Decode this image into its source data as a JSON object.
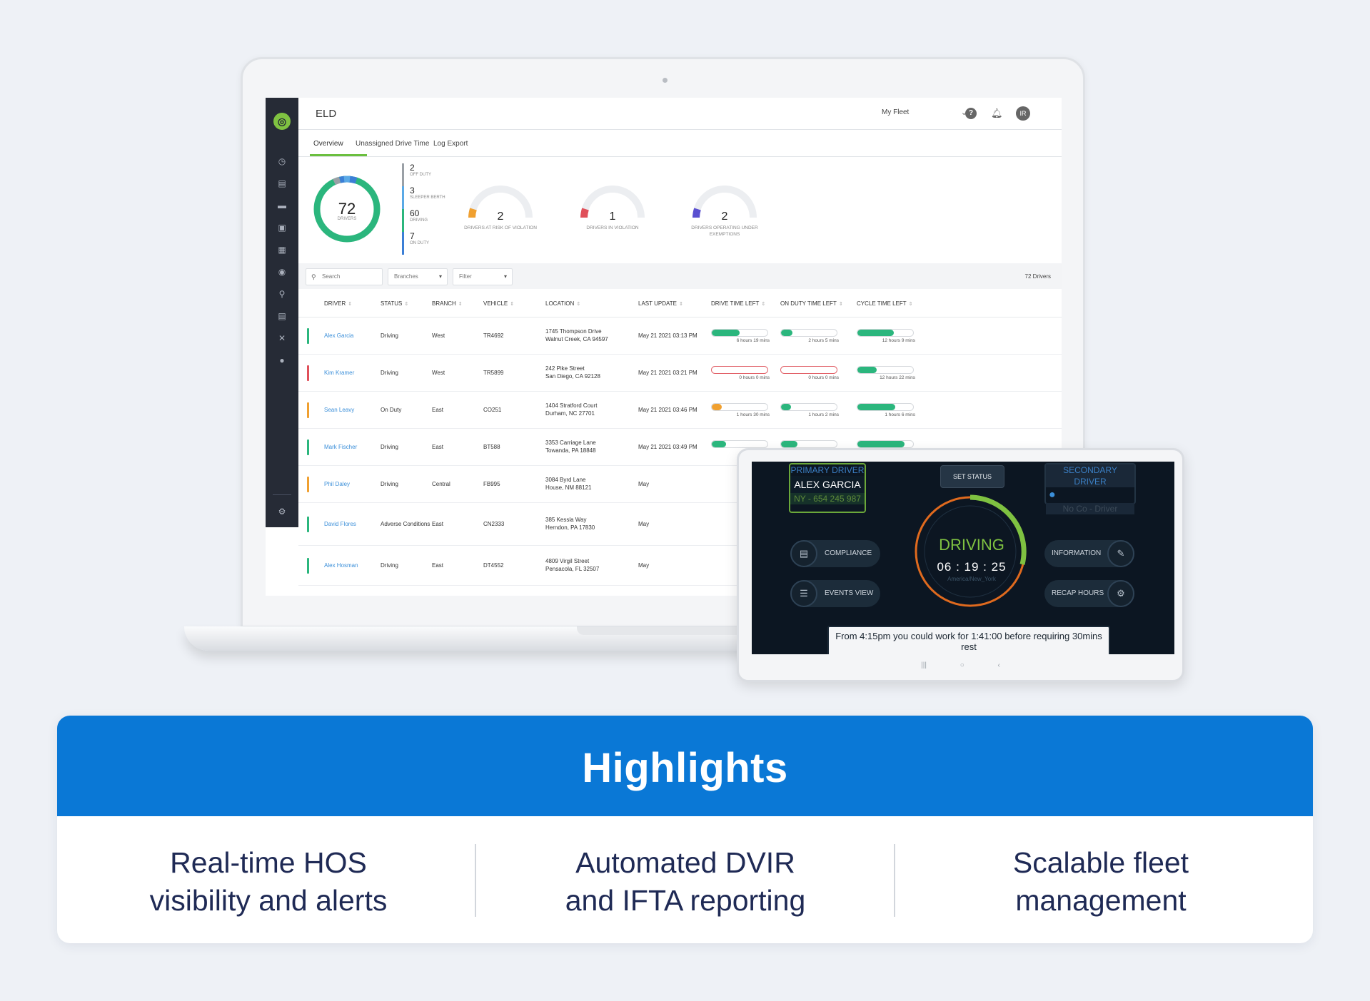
{
  "app": {
    "title": "ELD",
    "fleet_select": "My Fleet",
    "avatar_initials": "IR",
    "tabs": [
      "Overview",
      "Unassigned Drive Time",
      "Log Export"
    ]
  },
  "summary": {
    "total": "72",
    "total_label": "DRIVERS",
    "statuses": [
      {
        "count": "2",
        "label": "OFF DUTY",
        "color": "#9aa0a6"
      },
      {
        "count": "3",
        "label": "SLEEPER BERTH",
        "color": "#5aa9e6"
      },
      {
        "count": "60",
        "label": "DRIVING",
        "color": "#2bb67d"
      },
      {
        "count": "7",
        "label": "ON DUTY",
        "color": "#3b7fd6"
      }
    ],
    "gauges": [
      {
        "count": "2",
        "label": "DRIVERS AT RISK OF VIOLATION",
        "color": "#f0a030"
      },
      {
        "count": "1",
        "label": "DRIVERS IN VIOLATION",
        "color": "#e0505a"
      },
      {
        "count": "2",
        "label": "DRIVERS OPERATING UNDER EXEMPTIONS",
        "color": "#5a50d0"
      }
    ]
  },
  "toolbar": {
    "search_placeholder": "Search",
    "branches": "Branches",
    "filter": "Filter",
    "drivers_count": "72 Drivers"
  },
  "table": {
    "columns": [
      "DRIVER",
      "STATUS",
      "BRANCH",
      "VEHICLE",
      "LOCATION",
      "LAST UPDATE",
      "DRIVE TIME LEFT",
      "ON DUTY TIME LEFT",
      "CYCLE TIME LEFT"
    ],
    "rows": [
      {
        "color": "#2bb67d",
        "driver": "Alex Garcia",
        "status": "Driving",
        "branch": "West",
        "vehicle": "TR4692",
        "loc1": "1745  Thompson Drive",
        "loc2": "Walnut Creek, CA 94597",
        "updated": "May 21 2021 03:13 PM",
        "drive": {
          "fill": 0.5,
          "color": "#2bb67d",
          "text": "6 hours 19 mins"
        },
        "onduty": {
          "fill": 0.2,
          "color": "#2bb67d",
          "text": "2 hours 5 mins"
        },
        "cycle": {
          "fill": 0.65,
          "color": "#2bb67d",
          "text": "12 hours 9 mins"
        }
      },
      {
        "color": "#e0505a",
        "driver": "Kim Kramer",
        "status": "Driving",
        "branch": "West",
        "vehicle": "TR5899",
        "loc1": "242  Pike Street",
        "loc2": "San Diego, CA 92128",
        "updated": "May 21 2021 03:21 PM",
        "drive": {
          "fill": 0,
          "color": "#e0505a",
          "text": "0 hours 0 mins"
        },
        "onduty": {
          "fill": 0,
          "color": "#e0505a",
          "text": "0 hours 0 mins"
        },
        "cycle": {
          "fill": 0.35,
          "color": "#2bb67d",
          "text": "12 hours 22 mins"
        }
      },
      {
        "color": "#f0a030",
        "driver": "Sean Leavy",
        "status": "On Duty",
        "branch": "East",
        "vehicle": "CO251",
        "loc1": "1404  Stratford Court",
        "loc2": "Durham, NC 27701",
        "updated": "May 21 2021 03:46 PM",
        "drive": {
          "fill": 0.18,
          "color": "#f0a030",
          "text": "1 hours 30 mins"
        },
        "onduty": {
          "fill": 0.18,
          "color": "#2bb67d",
          "text": "1 hours 2 mins"
        },
        "cycle": {
          "fill": 0.68,
          "color": "#2bb67d",
          "text": "1 hours 6 mins"
        }
      },
      {
        "color": "#2bb67d",
        "driver": "Mark Fischer",
        "status": "Driving",
        "branch": "East",
        "vehicle": "BT588",
        "loc1": "3353  Carriage Lane",
        "loc2": "Towanda, PA 18848",
        "updated": "May 21 2021 03:49 PM",
        "drive": {
          "fill": 0.25,
          "color": "#2bb67d",
          "text": ""
        },
        "onduty": {
          "fill": 0.3,
          "color": "#2bb67d",
          "text": ""
        },
        "cycle": {
          "fill": 0.85,
          "color": "#2bb67d",
          "text": ""
        }
      },
      {
        "color": "#f0a030",
        "driver": "Phil Daley",
        "status": "Driving",
        "branch": "Central",
        "vehicle": "FB995",
        "loc1": "3084  Byrd Lane",
        "loc2": "House, NM 88121",
        "updated": "May"
      },
      {
        "color": "#2bb67d",
        "driver": "David Flores",
        "status": "Adverse Conditions",
        "branch": "East",
        "vehicle": "CN2333",
        "loc1": "385  Kessla Way",
        "loc2": "Herndon, PA 17830",
        "updated": "May"
      },
      {
        "color": "#2bb67d",
        "driver": "Alex Hosman",
        "status": "Driving",
        "branch": "East",
        "vehicle": "DT4552",
        "loc1": "4809  Virgil Street",
        "loc2": "Pensacola, FL 32507",
        "updated": "May"
      }
    ]
  },
  "tablet": {
    "primary_head": "PRIMARY DRIVER",
    "primary_name": "ALEX GARCIA",
    "primary_sub": "NY - 654 245 987",
    "set_status": "SET STATUS",
    "secondary_head": "SECONDARY DRIVER",
    "secondary_sub": "No Co - Driver",
    "compliance": "COMPLIANCE",
    "events_view": "EVENTS VIEW",
    "information": "INFORMATION",
    "recap_hours": "RECAP HOURS",
    "status": "DRIVING",
    "clock": "06 : 19 : 25",
    "timezone": "America/New_York",
    "message": "From 4:15pm you could work for 1:41:00 before requiring 30mins rest",
    "nav": [
      "|||",
      "○",
      "‹"
    ]
  },
  "highlights": {
    "title": "Highlights",
    "items": [
      {
        "line1": "Real-time HOS",
        "line2": "visibility and alerts"
      },
      {
        "line1": "Automated DVIR",
        "line2": "and IFTA reporting"
      },
      {
        "line1": "Scalable fleet",
        "line2": "management"
      }
    ]
  },
  "colors": {
    "brand_blue": "#0a78d6",
    "accent_green": "#7fc241",
    "sidebar": "#262b36"
  }
}
